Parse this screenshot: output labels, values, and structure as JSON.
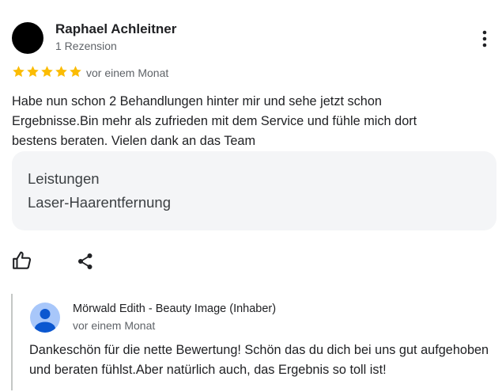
{
  "review": {
    "author_name": "Raphael Achleitner",
    "author_subtitle": "1 Rezension",
    "rating": 5,
    "rating_max": 5,
    "time": "vor einem Monat",
    "text": "Habe nun schon 2 Behandlungen hinter mir und sehe jetzt schon Ergebnisse.Bin mehr als zufrieden mit dem Service und fühle mich dort bestens beraten. Vielen dank an das Team",
    "services_label": "Leistungen",
    "services_value": "Laser-Haarentfernung",
    "more_icon": "more-vert-icon",
    "like_icon": "thumb-up-icon",
    "share_icon": "share-icon"
  },
  "owner_reply": {
    "name": "Mörwald Edith - Beauty Image (Inhaber)",
    "time": "vor einem Monat",
    "text": "Dankeschön für die nette Bewertung! Schön das du dich bei uns gut aufgehoben und beraten fühlst.Aber natürlich auch, das Ergebnis so toll ist!",
    "avatar_icon": "default-profile-icon"
  },
  "colors": {
    "star": "#fbbc04",
    "avatar_bg": "#000000",
    "owner_avatar_bg": "#a8c7fa",
    "owner_avatar_fg": "#0b57d0",
    "services_bg": "#f4f5f7"
  }
}
